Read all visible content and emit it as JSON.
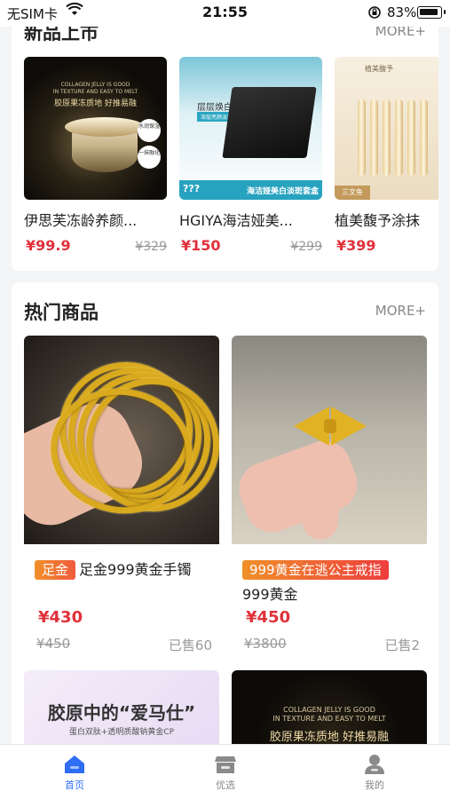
{
  "status_bar": {
    "carrier": "无SIM卡",
    "time": "21:55",
    "battery_pct": "83%"
  },
  "new_arrivals": {
    "title": "新品上市",
    "more": "MORE+",
    "items": [
      {
        "name": "伊思芙冻龄养颜...",
        "price": "¥99.9",
        "original_price": "¥329",
        "image_lines": [
          "COLLAGEN JELLY IS GOOD",
          "IN TEXTURE AND EASY TO MELT",
          "胶原果冻质地 好推易融"
        ],
        "image_badges": [
          "水润保湿",
          "一抹融化"
        ]
      },
      {
        "name": "HGIYA海洁娅美...",
        "price": "¥150",
        "original_price": "¥299",
        "image_lines": [
          "层层焕白",
          "深层亮颜淡斑",
          "???",
          "海洁娅美白淡斑套盒"
        ]
      },
      {
        "name": "植美馥予涂抹",
        "price": "¥399",
        "original_price": "",
        "image_lines": [
          "植美馥予",
          "三文鱼"
        ]
      }
    ]
  },
  "hot_products": {
    "title": "热门商品",
    "more": "MORE+",
    "items": [
      {
        "tag": "足金",
        "name": "足金999黄金手镯",
        "price": "¥430",
        "original_price": "¥450",
        "sold": "已售60"
      },
      {
        "tag": "999黄金在逃公主戒指",
        "name": "999黄金",
        "price": "¥450",
        "original_price": "¥3800",
        "sold": "已售2"
      }
    ],
    "partial_items": [
      {
        "image_title": "胶原中的“爱马仕”",
        "image_sub": "蛋白双肽+透明质酸钠黄金CP"
      },
      {
        "image_lines": [
          "COLLAGEN JELLY IS GOOD",
          "IN TEXTURE AND EASY TO MELT",
          "胶原果冻质地 好推易融"
        ]
      }
    ]
  },
  "tab_bar": {
    "tabs": [
      {
        "label": "首页",
        "icon": "home-icon",
        "active": true
      },
      {
        "label": "优选",
        "icon": "store-icon",
        "active": false
      },
      {
        "label": "我的",
        "icon": "user-icon",
        "active": false
      }
    ],
    "active_color": "#2f6df6",
    "inactive_color": "#888888"
  },
  "colors": {
    "price": "#e0313b",
    "tag": "#f05b3d",
    "background": "#f4f5f7"
  }
}
